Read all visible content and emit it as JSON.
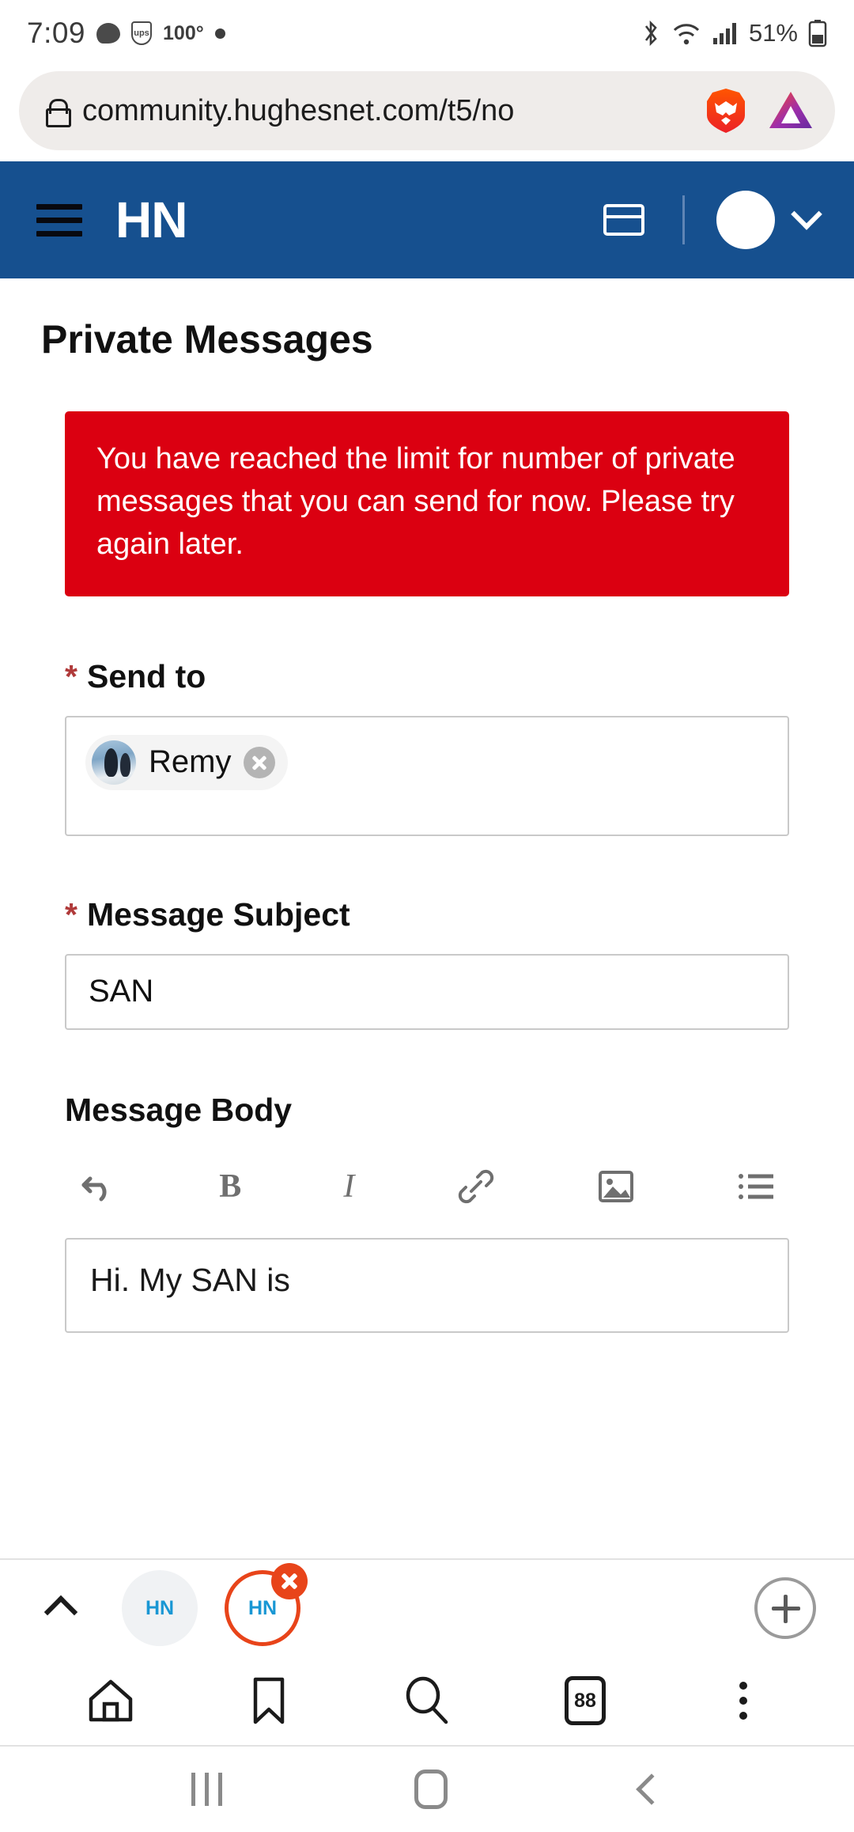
{
  "status_bar": {
    "time": "7:09",
    "chat_icon": "chat-bubble-icon",
    "ups_icon": "ups-icon",
    "ups_label": "ups",
    "temperature": "100°",
    "dot_icon": "dot-indicator-icon",
    "bluetooth_icon": "bluetooth-icon",
    "wifi_icon": "wifi-icon",
    "signal_icon": "cellular-signal-icon",
    "battery_percent": "51%",
    "battery_icon": "battery-icon"
  },
  "browser": {
    "url": "community.hughesnet.com/t5/no",
    "lock_icon": "lock-icon",
    "brave_icon": "brave-lion-icon",
    "bat_icon": "bat-triangle-icon",
    "tabstrip": {
      "expand_icon": "chevron-up-icon",
      "tabs": [
        {
          "label": "HN",
          "active": false,
          "name": "browser-tab-hn-inactive"
        },
        {
          "label": "HN",
          "active": true,
          "name": "browser-tab-hn-active",
          "close_icon": "close-icon"
        }
      ],
      "new_tab_icon": "plus-icon"
    },
    "bottom_nav": [
      {
        "name": "home-icon",
        "label": "Home"
      },
      {
        "name": "bookmark-icon",
        "label": "Bookmarks"
      },
      {
        "name": "search-icon",
        "label": "Search"
      },
      {
        "name": "tabs-icon",
        "label": "88"
      },
      {
        "name": "kebab-menu-icon",
        "label": "More"
      }
    ]
  },
  "site_header": {
    "menu_icon": "hamburger-menu-icon",
    "logo": "HN",
    "inbox_icon": "inbox-card-icon",
    "avatar_icon": "user-avatar",
    "chevron_icon": "chevron-down-icon"
  },
  "page": {
    "title": "Private Messages",
    "alert": {
      "text": "You have reached the limit for number of private messages that you can send for now. Please try again later.",
      "color": "#db0011"
    },
    "send_to": {
      "required_marker": "*",
      "label": "Send to",
      "recipient": "Remy",
      "avatar_icon": "recipient-avatar",
      "remove_icon": "remove-recipient-icon"
    },
    "subject": {
      "required_marker": "*",
      "label": "Message Subject",
      "value": "SAN"
    },
    "body": {
      "label": "Message Body",
      "value": "Hi.  My SAN is",
      "toolbar": [
        {
          "name": "undo-icon",
          "label": "Undo"
        },
        {
          "name": "bold-icon",
          "label": "B"
        },
        {
          "name": "italic-icon",
          "label": "I"
        },
        {
          "name": "link-icon",
          "label": "Link"
        },
        {
          "name": "image-icon",
          "label": "Image"
        },
        {
          "name": "bullet-list-icon",
          "label": "List"
        }
      ]
    }
  },
  "system_nav": {
    "recents_icon": "recents-icon",
    "home_icon": "home-button-icon",
    "back_icon": "back-icon"
  },
  "colors": {
    "header_blue": "#16508f",
    "alert_red": "#db0011",
    "brave_orange": "#e8441a",
    "tab_blue": "#1997d4"
  }
}
